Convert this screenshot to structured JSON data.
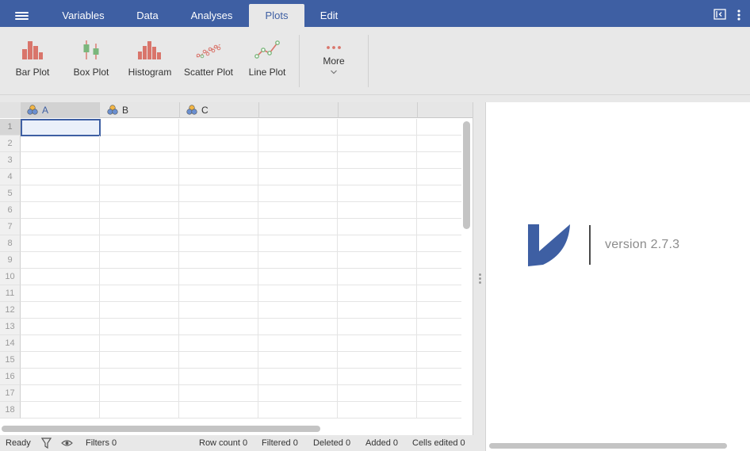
{
  "menu": {
    "tabs": [
      {
        "label": "Variables"
      },
      {
        "label": "Data"
      },
      {
        "label": "Analyses"
      },
      {
        "label": "Plots"
      },
      {
        "label": "Edit"
      }
    ],
    "active_tab": "Plots",
    "icons": [
      "hamburger-menu-icon",
      "results-mode-icon",
      "more-options-icon"
    ]
  },
  "ribbon": {
    "buttons": [
      {
        "label": "Bar Plot",
        "icon": "bar-plot-icon"
      },
      {
        "label": "Box Plot",
        "icon": "box-plot-icon"
      },
      {
        "label": "Histogram",
        "icon": "histogram-icon"
      },
      {
        "label": "Scatter Plot",
        "icon": "scatter-plot-icon"
      },
      {
        "label": "Line Plot",
        "icon": "line-plot-icon"
      }
    ],
    "more_label": "More"
  },
  "spreadsheet": {
    "columns": [
      {
        "name": "A",
        "icon": "nominal-variable-icon"
      },
      {
        "name": "B",
        "icon": "nominal-variable-icon"
      },
      {
        "name": "C",
        "icon": "nominal-variable-icon"
      }
    ],
    "row_numbers": [
      "1",
      "2",
      "3",
      "4",
      "5",
      "6",
      "7",
      "8",
      "9",
      "10",
      "11",
      "12",
      "13",
      "14",
      "15",
      "16",
      "17",
      "18"
    ],
    "selected_cell": {
      "column": "A",
      "row": "1"
    }
  },
  "results": {
    "version_text": "version 2.7.3"
  },
  "statusbar": {
    "ready": "Ready",
    "filters": "Filters 0",
    "row_count": "Row count 0",
    "filtered": "Filtered 0",
    "deleted": "Deleted 0",
    "added": "Added 0",
    "cells_edited": "Cells edited 0"
  },
  "colors": {
    "accent": "#3e5fa3",
    "plot_icon": "#d9756b",
    "box_icon": "#7bb67c"
  }
}
